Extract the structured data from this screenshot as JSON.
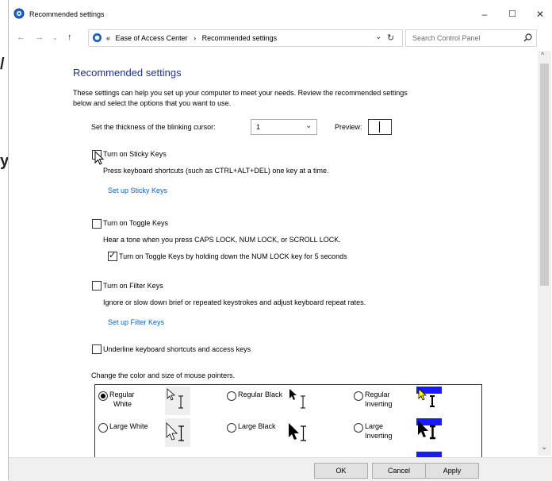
{
  "window": {
    "title": "Recommended settings",
    "controls": {
      "minimize": "–",
      "maximize": "☐",
      "close": "✕"
    }
  },
  "left_fragments": [
    "/",
    "y"
  ],
  "address_bar": {
    "prefix": "«",
    "breadcrumbs": [
      "Ease of Access Center",
      "Recommended settings"
    ],
    "separator": "›",
    "search_placeholder": "Search Control Panel"
  },
  "page": {
    "heading": "Recommended settings",
    "intro": "These settings can help you set up your computer to meet your needs. Review the recommended settings below and select the options that you want to use.",
    "intro_line1": "These settings can help you set up your computer to meet your needs. Review the recommended settings",
    "intro_line2": "below and select the options that you want to use.",
    "cursor_thickness_label": "Set the thickness of the blinking cursor:",
    "cursor_thickness_value": "1",
    "preview_label": "Preview:",
    "sticky": {
      "label": "Turn on Sticky Keys",
      "checked": false,
      "desc": "Press keyboard shortcuts (such as CTRL+ALT+DEL) one key at a time.",
      "link": "Set up Sticky Keys"
    },
    "toggle": {
      "label": "Turn on Toggle Keys",
      "checked": false,
      "desc": "Hear a tone when you press CAPS LOCK, NUM LOCK, or SCROLL LOCK.",
      "sub_label": "Turn on Toggle Keys by holding down the NUM LOCK key for 5 seconds",
      "sub_checked": true
    },
    "filter": {
      "label": "Turn on Filter Keys",
      "checked": false,
      "desc": "Ignore or slow down brief or repeated keystrokes and adjust keyboard repeat rates.",
      "link": "Set up Filter Keys"
    },
    "underline": {
      "label": "Underline keyboard shortcuts and access keys",
      "checked": false
    },
    "pointer_heading": "Change the color and size of mouse pointers.",
    "pointers": [
      {
        "label_1": "Regular",
        "label_2": "White",
        "selected": true
      },
      {
        "label_1": "Regular Black",
        "label_2": "",
        "selected": false
      },
      {
        "label_1": "Regular",
        "label_2": "Inverting",
        "selected": false
      },
      {
        "label_1": "Large White",
        "label_2": "",
        "selected": false
      },
      {
        "label_1": "Large Black",
        "label_2": "",
        "selected": false
      },
      {
        "label_1": "Large",
        "label_2": "Inverting",
        "selected": false
      }
    ]
  },
  "footer": {
    "ok": "OK",
    "cancel": "Cancel",
    "apply": "Apply"
  },
  "colors": {
    "heading": "#1e3287",
    "link": "#0066cc",
    "inverting_band": "#1a1aff",
    "inverting_yellow": "#ffff00"
  }
}
